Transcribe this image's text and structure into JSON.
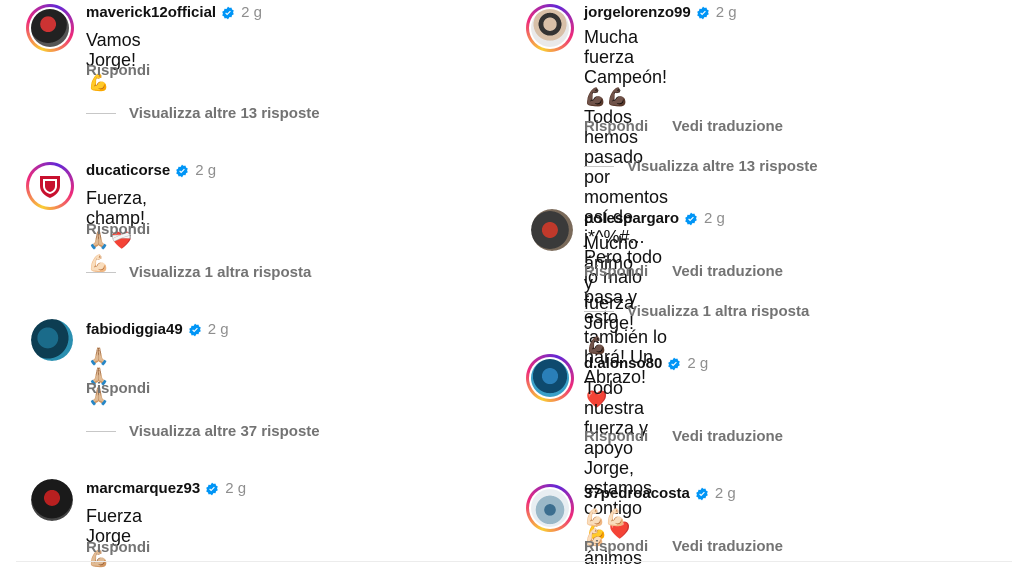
{
  "common": {
    "reply_label": "Rispondi",
    "translate_label": "Vedi traduzione"
  },
  "left": [
    {
      "username": "maverick12official",
      "time": "2 g",
      "text": "Vamos Jorge!",
      "emojis": [
        "💪"
      ],
      "more_replies": "Visualizza altre 13 risposte"
    },
    {
      "username": "ducaticorse",
      "time": "2 g",
      "text": "Fuerza, champ!",
      "emojis": [
        "🙏🏼",
        "❤️‍🩹",
        "💪🏻"
      ],
      "more_replies": "Visualizza 1 altra risposta"
    },
    {
      "username": "fabiodiggia49",
      "time": "2 g",
      "text": "",
      "emojis": [
        "🙏🏼🙏🏼🙏🏼"
      ],
      "more_replies": "Visualizza altre 37 risposte"
    },
    {
      "username": "marcmarquez93",
      "time": "2 g",
      "text": "Fuerza Jorge",
      "emojis": [
        "💪🏼"
      ],
      "more_replies": ""
    }
  ],
  "right": [
    {
      "username": "jorgelorenzo99",
      "time": "2 g",
      "text": "Mucha fuerza Campeón! 💪🏿💪🏿 Todos hemos\npasado por momentos así de j*^%#... Pero todo\nlo malo pasa y esto también lo hará! Un Abrazo!",
      "emojis": [
        "❤️"
      ],
      "more_replies": "Visualizza altre 13 risposte"
    },
    {
      "username": "polespargaro",
      "time": "2 g",
      "text": "Mucho ánimo y fuerza Jorge!",
      "emojis": [
        "💪🏿"
      ],
      "more_replies": "Visualizza 1 altra risposta"
    },
    {
      "username": "d.alonso80",
      "time": "2 g",
      "text": "Todo nuestra fuerza y apoyo Jorge, estamos\ncontigo",
      "emojis": [
        "💪",
        "❤️"
      ],
      "more_replies": ""
    },
    {
      "username": "37pedroacosta",
      "time": "2 g",
      "text": "ánimos tío!",
      "emojis": [
        "💪🏻💪🏻💪🏻"
      ],
      "more_replies": ""
    }
  ],
  "colors": {
    "verified": "#0095f6",
    "secondary_text": "#737373",
    "story_ring": [
      "#f9ce34",
      "#ee2a7b",
      "#6228d7"
    ]
  }
}
